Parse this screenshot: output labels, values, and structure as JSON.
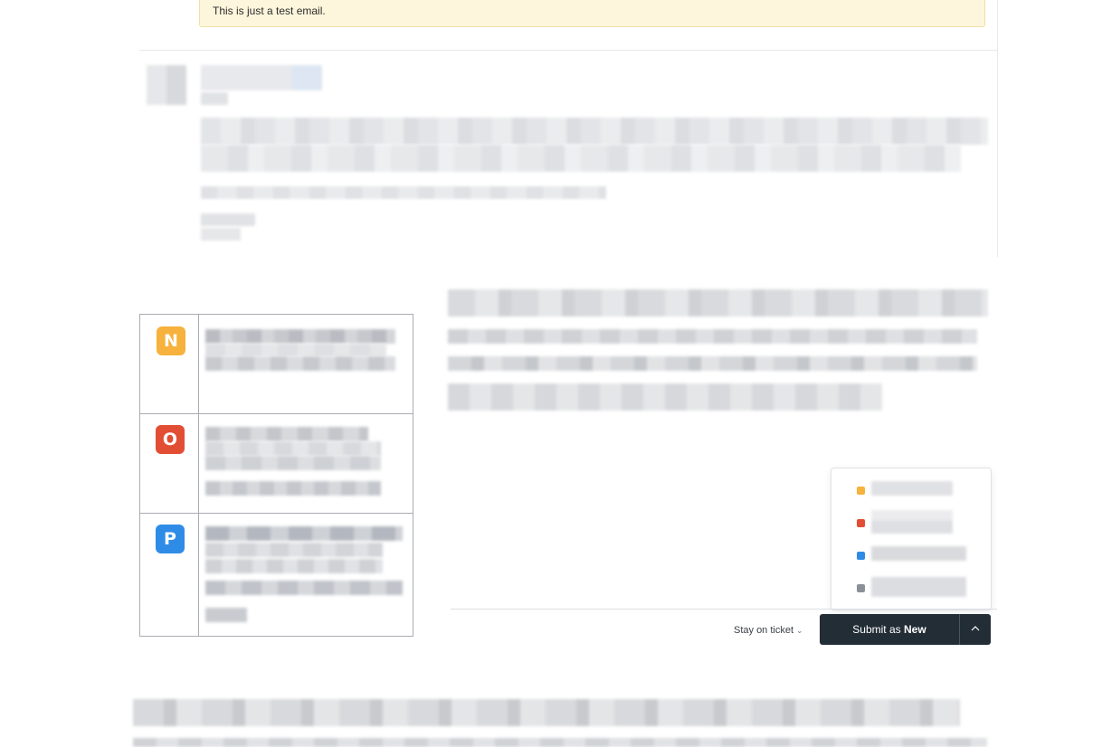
{
  "email": {
    "body_text": "This is just a test email."
  },
  "legend_badges": [
    {
      "letter": "N",
      "color": "#f6b23c"
    },
    {
      "letter": "O",
      "color": "#e24e33"
    },
    {
      "letter": "P",
      "color": "#2f8ce6"
    }
  ],
  "status_menu": {
    "items": [
      {
        "color": "#f6b23c"
      },
      {
        "color": "#e24e33"
      },
      {
        "color": "#2f8ce6"
      },
      {
        "color": "#8a9099"
      }
    ]
  },
  "footer": {
    "stay_label": "Stay on ticket",
    "submit_prefix": "Submit as ",
    "submit_status": "New"
  }
}
